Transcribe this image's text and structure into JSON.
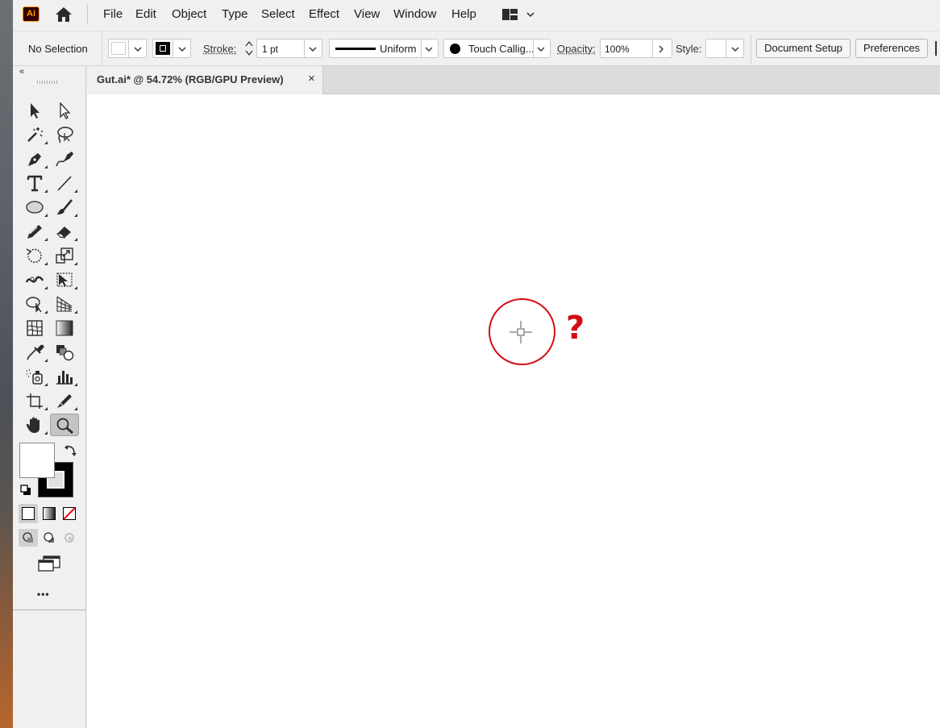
{
  "app": {
    "logo_text": "Ai",
    "accent_color": "#ff9a00",
    "home_icon": "home-icon"
  },
  "menubar": {
    "items": [
      "File",
      "Edit",
      "Object",
      "Type",
      "Select",
      "Effect",
      "View",
      "Window",
      "Help"
    ],
    "workspace_icon": "workspace-switcher-icon"
  },
  "controlbar": {
    "selection_status": "No Selection",
    "stroke_label": "Stroke:",
    "stroke_weight": "1 pt",
    "variable_width_profile": "Uniform",
    "brush_definition": "Touch Callig...",
    "opacity_label": "Opacity:",
    "opacity_value": "100%",
    "style_label": "Style:",
    "document_setup_label": "Document Setup",
    "preferences_label": "Preferences"
  },
  "document": {
    "tab_title": "Gut.ai* @ 54.72% (RGB/GPU Preview)",
    "close_glyph": "×"
  },
  "toolbar": {
    "collapse_glyph": "«",
    "more_glyph": "•••",
    "fill_color": "#ffffff",
    "stroke_color": "#000000",
    "active_tool": "zoom-tool"
  },
  "annotation": {
    "mark": "?",
    "color": "#d40d12"
  }
}
